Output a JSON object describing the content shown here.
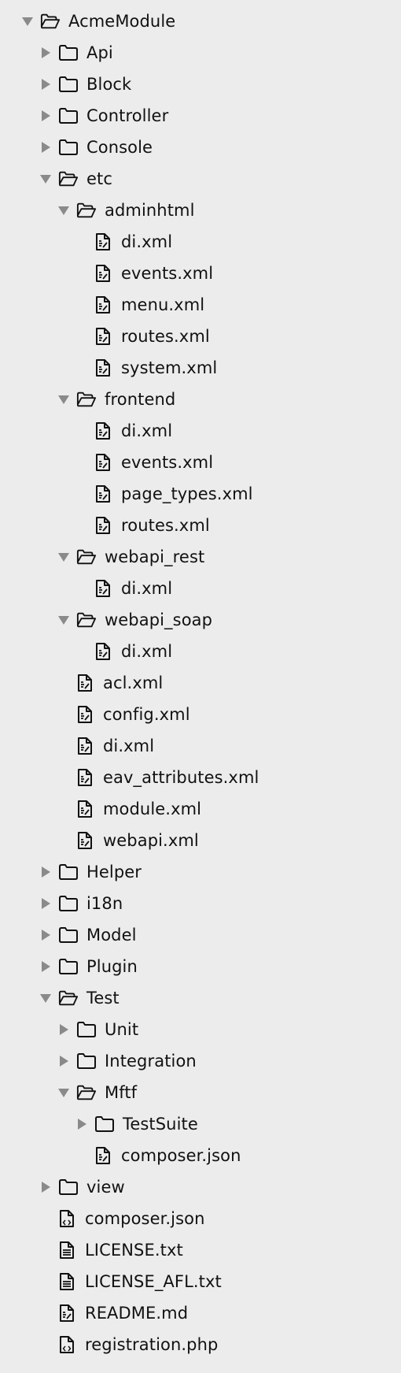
{
  "tree": [
    {
      "name": "AcmeModule",
      "type": "folder",
      "depth": 0,
      "expanded": true
    },
    {
      "name": "Api",
      "type": "folder",
      "depth": 1,
      "expanded": false
    },
    {
      "name": "Block",
      "type": "folder",
      "depth": 1,
      "expanded": false
    },
    {
      "name": "Controller",
      "type": "folder",
      "depth": 1,
      "expanded": false
    },
    {
      "name": "Console",
      "type": "folder",
      "depth": 1,
      "expanded": false
    },
    {
      "name": "etc",
      "type": "folder",
      "depth": 1,
      "expanded": true
    },
    {
      "name": "adminhtml",
      "type": "folder",
      "depth": 2,
      "expanded": true
    },
    {
      "name": "di.xml",
      "type": "file",
      "icon": "text-file-icon",
      "depth": 3
    },
    {
      "name": "events.xml",
      "type": "file",
      "icon": "text-file-icon",
      "depth": 3
    },
    {
      "name": "menu.xml",
      "type": "file",
      "icon": "text-file-icon",
      "depth": 3
    },
    {
      "name": "routes.xml",
      "type": "file",
      "icon": "text-file-icon",
      "depth": 3
    },
    {
      "name": "system.xml",
      "type": "file",
      "icon": "text-file-icon",
      "depth": 3
    },
    {
      "name": "frontend",
      "type": "folder",
      "depth": 2,
      "expanded": true
    },
    {
      "name": "di.xml",
      "type": "file",
      "icon": "text-file-icon",
      "depth": 3
    },
    {
      "name": "events.xml",
      "type": "file",
      "icon": "text-file-icon",
      "depth": 3
    },
    {
      "name": "page_types.xml",
      "type": "file",
      "icon": "text-file-icon",
      "depth": 3
    },
    {
      "name": "routes.xml",
      "type": "file",
      "icon": "text-file-icon",
      "depth": 3
    },
    {
      "name": "webapi_rest",
      "type": "folder",
      "depth": 2,
      "expanded": true
    },
    {
      "name": "di.xml",
      "type": "file",
      "icon": "text-file-icon",
      "depth": 3
    },
    {
      "name": "webapi_soap",
      "type": "folder",
      "depth": 2,
      "expanded": true
    },
    {
      "name": "di.xml",
      "type": "file",
      "icon": "text-file-icon",
      "depth": 3
    },
    {
      "name": "acl.xml",
      "type": "file",
      "icon": "text-file-icon",
      "depth": 2
    },
    {
      "name": "config.xml",
      "type": "file",
      "icon": "text-file-icon",
      "depth": 2
    },
    {
      "name": "di.xml",
      "type": "file",
      "icon": "text-file-icon",
      "depth": 2
    },
    {
      "name": "eav_attributes.xml",
      "type": "file",
      "icon": "text-file-icon",
      "depth": 2
    },
    {
      "name": "module.xml",
      "type": "file",
      "icon": "text-file-icon",
      "depth": 2
    },
    {
      "name": "webapi.xml",
      "type": "file",
      "icon": "text-file-icon",
      "depth": 2
    },
    {
      "name": "Helper",
      "type": "folder",
      "depth": 1,
      "expanded": false
    },
    {
      "name": "i18n",
      "type": "folder",
      "depth": 1,
      "expanded": false
    },
    {
      "name": "Model",
      "type": "folder",
      "depth": 1,
      "expanded": false
    },
    {
      "name": "Plugin",
      "type": "folder",
      "depth": 1,
      "expanded": false
    },
    {
      "name": "Test",
      "type": "folder",
      "depth": 1,
      "expanded": true
    },
    {
      "name": "Unit",
      "type": "folder",
      "depth": 2,
      "expanded": false
    },
    {
      "name": "Integration",
      "type": "folder",
      "depth": 2,
      "expanded": false
    },
    {
      "name": "Mftf",
      "type": "folder",
      "depth": 2,
      "expanded": true
    },
    {
      "name": "TestSuite",
      "type": "folder",
      "depth": 3,
      "expanded": false
    },
    {
      "name": "composer.json",
      "type": "file",
      "icon": "text-file-icon",
      "depth": 3
    },
    {
      "name": "view",
      "type": "folder",
      "depth": 1,
      "expanded": false
    },
    {
      "name": "composer.json",
      "type": "file",
      "icon": "code-file-icon",
      "depth": 1
    },
    {
      "name": "LICENSE.txt",
      "type": "file",
      "icon": "document-file-icon",
      "depth": 1
    },
    {
      "name": "LICENSE_AFL.txt",
      "type": "file",
      "icon": "document-file-icon",
      "depth": 1
    },
    {
      "name": "README.md",
      "type": "file",
      "icon": "text-file-icon",
      "depth": 1
    },
    {
      "name": "registration.php",
      "type": "file",
      "icon": "code-file-icon",
      "depth": 1
    }
  ],
  "colors": {
    "background": "#ececec",
    "text": "#111111",
    "disclosure_arrow": "#8a8a8a",
    "icon_stroke": "#111111"
  }
}
